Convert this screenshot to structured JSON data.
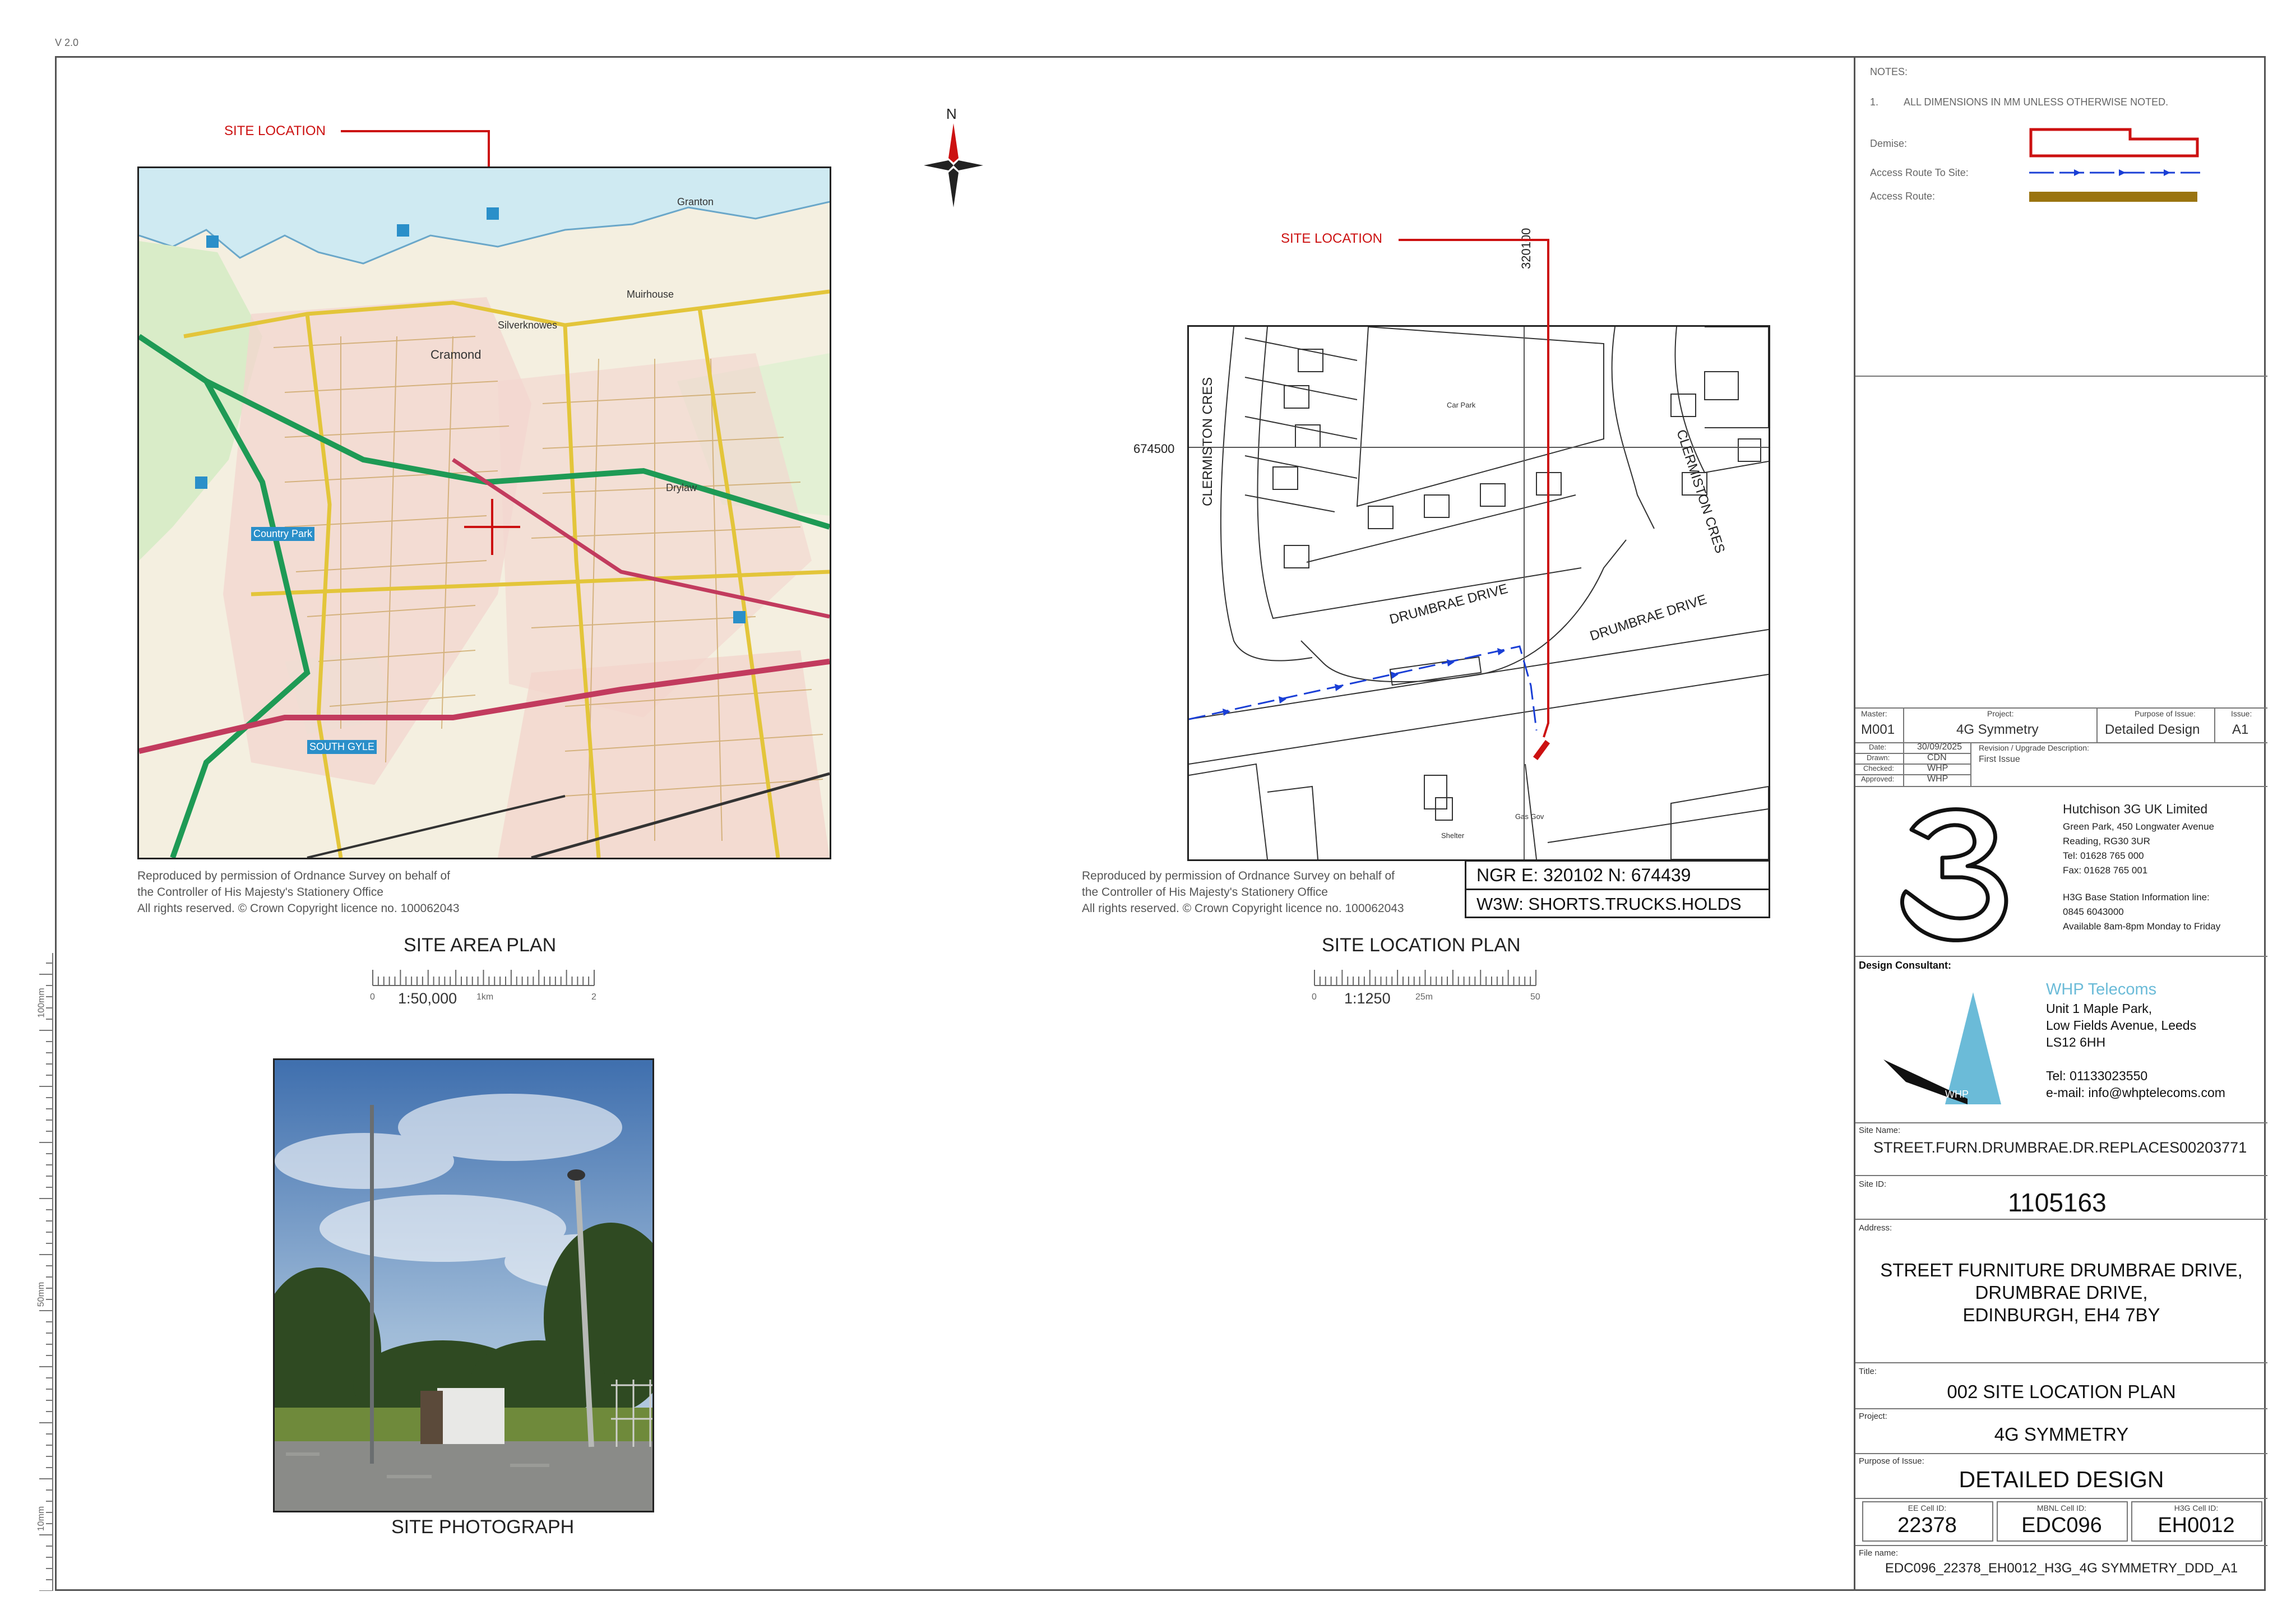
{
  "version": "V 2.0",
  "margin_scale": {
    "label_100": "100mm",
    "label_50": "50mm",
    "label_10": "10mm"
  },
  "area_plan": {
    "site_location_label": "SITE LOCATION",
    "map_labels": [
      "Cramond",
      "Country Park",
      "Silverknowes",
      "Muirhouse",
      "Granton",
      "Drylaw",
      "SOUTH GYLE"
    ],
    "copyright": [
      "Reproduced by permission of Ordnance Survey on behalf of",
      "the Controller of His Majesty's Stationery Office",
      "All rights reserved. © Crown Copyright licence no. 100062043"
    ],
    "title": "SITE AREA PLAN",
    "scale": "1:50,000",
    "tick_0": "0",
    "tick_mid": "1km",
    "tick_end": "2"
  },
  "north_arrow": {
    "label": "N"
  },
  "location_plan": {
    "site_location_label": "SITE LOCATION",
    "easting_label": "320100",
    "northing_label": "674500",
    "streets": [
      "CLERMISTON CRES",
      "CLERMISTON CRES",
      "DRUMBRAE DRIVE",
      "DRUMBRAE DRIVE"
    ],
    "map_notes": [
      "Car Park",
      "Shelter",
      "Gas Gov"
    ],
    "ngr": "NGR  E: 320102  N: 674439",
    "w3w": "W3W: SHORTS.TRUCKS.HOLDS",
    "copyright": [
      "Reproduced by permission of Ordnance Survey on behalf of",
      "the Controller of His Majesty's Stationery Office",
      "All rights reserved. © Crown Copyright licence no. 100062043"
    ],
    "title": "SITE LOCATION PLAN",
    "scale": "1:1250",
    "tick_0": "0",
    "tick_mid": "25m",
    "tick_end": "50"
  },
  "photo": {
    "caption": "SITE PHOTOGRAPH"
  },
  "title_block": {
    "notes_heading": "NOTES:",
    "note_1_number": "1.",
    "note_1_text": "ALL DIMENSIONS IN MM UNLESS OTHERWISE NOTED.",
    "legend_demise": "Demise:",
    "legend_access_to_site": "Access Route To Site:",
    "legend_access_route": "Access Route:",
    "colors": {
      "demise": "#cc1111",
      "access_to_site": "#1a3fd6",
      "access_route": "#9a7410",
      "whp_blue": "#6bbbd8"
    },
    "master_label": "Master:",
    "master_value": "M001",
    "project_label": "Project:",
    "project_value": "4G Symmetry",
    "purpose_label": "Purpose of Issue:",
    "purpose_value": "Detailed Design",
    "issue_label": "Issue:",
    "issue_value": "A1",
    "date_label": "Date:",
    "date_value": "30/09/2025",
    "drawn_label": "Drawn:",
    "drawn_value": "CDN",
    "checked_label": "Checked:",
    "checked_value": "WHP",
    "approved_label": "Approved:",
    "approved_value": "WHP",
    "revision_label": "Revision / Upgrade Description:",
    "revision_value": "First Issue",
    "h3g": {
      "company": "Hutchison 3G UK Limited",
      "addr1": "Green Park, 450 Longwater Avenue",
      "addr2": "Reading, RG30 3UR",
      "tel": "Tel: 01628 765 000",
      "fax": "Fax: 01628 765 001",
      "info_line": "H3G Base Station Information line:",
      "info_number": "0845 6043000",
      "hours": "Available 8am-8pm Monday to Friday"
    },
    "design_consultant_label": "Design Consultant:",
    "whp": {
      "name": "WHP Telecoms",
      "addr1": "Unit 1 Maple Park,",
      "addr2": "Low Fields Avenue, Leeds",
      "addr3": "LS12 6HH",
      "tel": "Tel: 01133023550",
      "email": "e-mail: info@whptelecoms.com",
      "logo_text": "WHP"
    },
    "site_name_label": "Site Name:",
    "site_name_value": "STREET.FURN.DRUMBRAE.DR.REPLACES00203771",
    "site_id_label": "Site ID:",
    "site_id_value": "1105163",
    "address_label": "Address:",
    "address_line1": "STREET FURNITURE DRUMBRAE DRIVE,",
    "address_line2": "DRUMBRAE DRIVE,",
    "address_line3": "EDINBURGH, EH4 7BY",
    "title_label": "Title:",
    "title_value": "002 SITE LOCATION PLAN",
    "project2_label": "Project:",
    "project2_value": "4G SYMMETRY",
    "purpose2_label": "Purpose of Issue:",
    "purpose2_value": "DETAILED DESIGN",
    "ee_label": "EE Cell ID:",
    "ee_value": "22378",
    "mbnl_label": "MBNL Cell ID:",
    "mbnl_value": "EDC096",
    "h3g_label": "H3G Cell ID:",
    "h3g_value": "EH0012",
    "file_label": "File name:",
    "file_value": "EDC096_22378_EH0012_H3G_4G SYMMETRY_DDD_A1"
  }
}
